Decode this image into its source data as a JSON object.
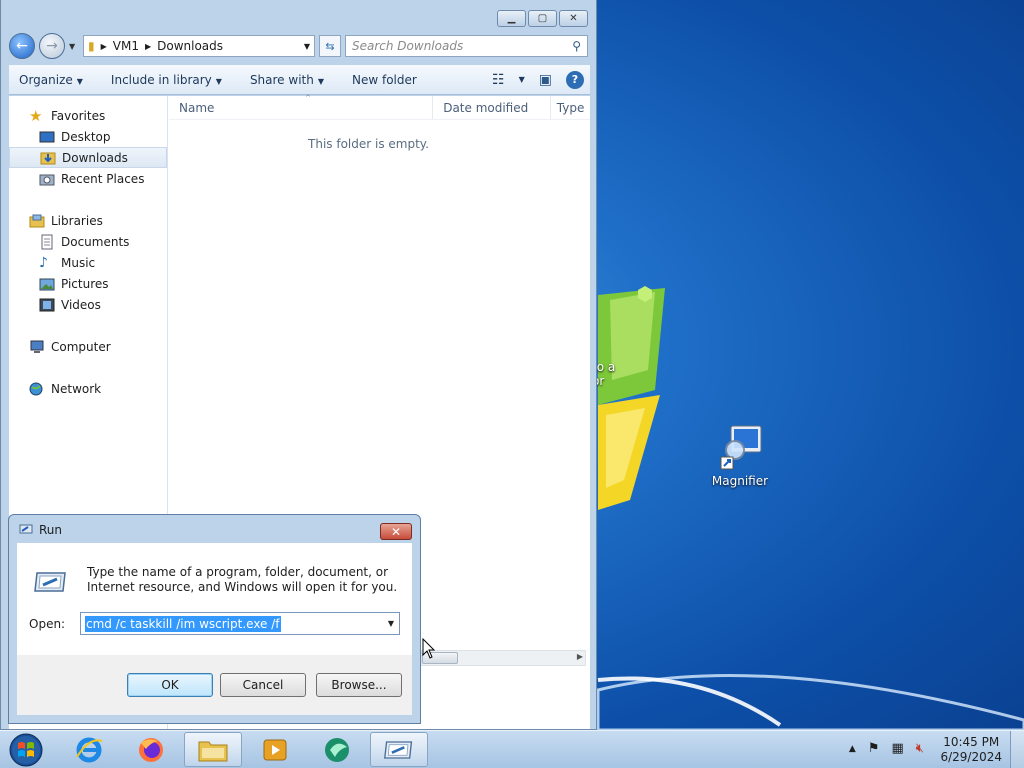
{
  "explorer": {
    "caption": {
      "minimize": "▭",
      "maximize": "▢",
      "close": "✕"
    },
    "address": {
      "root": "VM1",
      "folder": "Downloads"
    },
    "search": {
      "placeholder": "Search Downloads"
    },
    "toolbar": {
      "organize": "Organize",
      "include_in_library": "Include in library",
      "share_with": "Share with",
      "new_folder": "New folder"
    },
    "nav": {
      "favorites": "Favorites",
      "desktop": "Desktop",
      "downloads": "Downloads",
      "recent_places": "Recent Places",
      "libraries": "Libraries",
      "documents": "Documents",
      "music": "Music",
      "pictures": "Pictures",
      "videos": "Videos",
      "computer": "Computer",
      "network": "Network"
    },
    "columns": {
      "name": "Name",
      "date_modified": "Date modified",
      "type": "Type"
    },
    "empty_message": "This folder is empty."
  },
  "desktop": {
    "magnifier_label": "Magnifier",
    "partial_label_1": "to a",
    "partial_label_2": "or"
  },
  "run": {
    "title": "Run",
    "description": "Type the name of a program, folder, document, or Internet resource, and Windows will open it for you.",
    "open_label": "Open:",
    "command_value": "cmd /c taskkill /im wscript.exe /f",
    "ok": "OK",
    "cancel": "Cancel",
    "browse": "Browse..."
  },
  "taskbar": {
    "time": "10:45 PM",
    "date": "6/29/2024"
  },
  "colors": {
    "explorer_frame": "#bcd3ea",
    "taskbar": "#a6c4e3",
    "selection": "#3399ff",
    "close_red": "#c74c3a"
  }
}
